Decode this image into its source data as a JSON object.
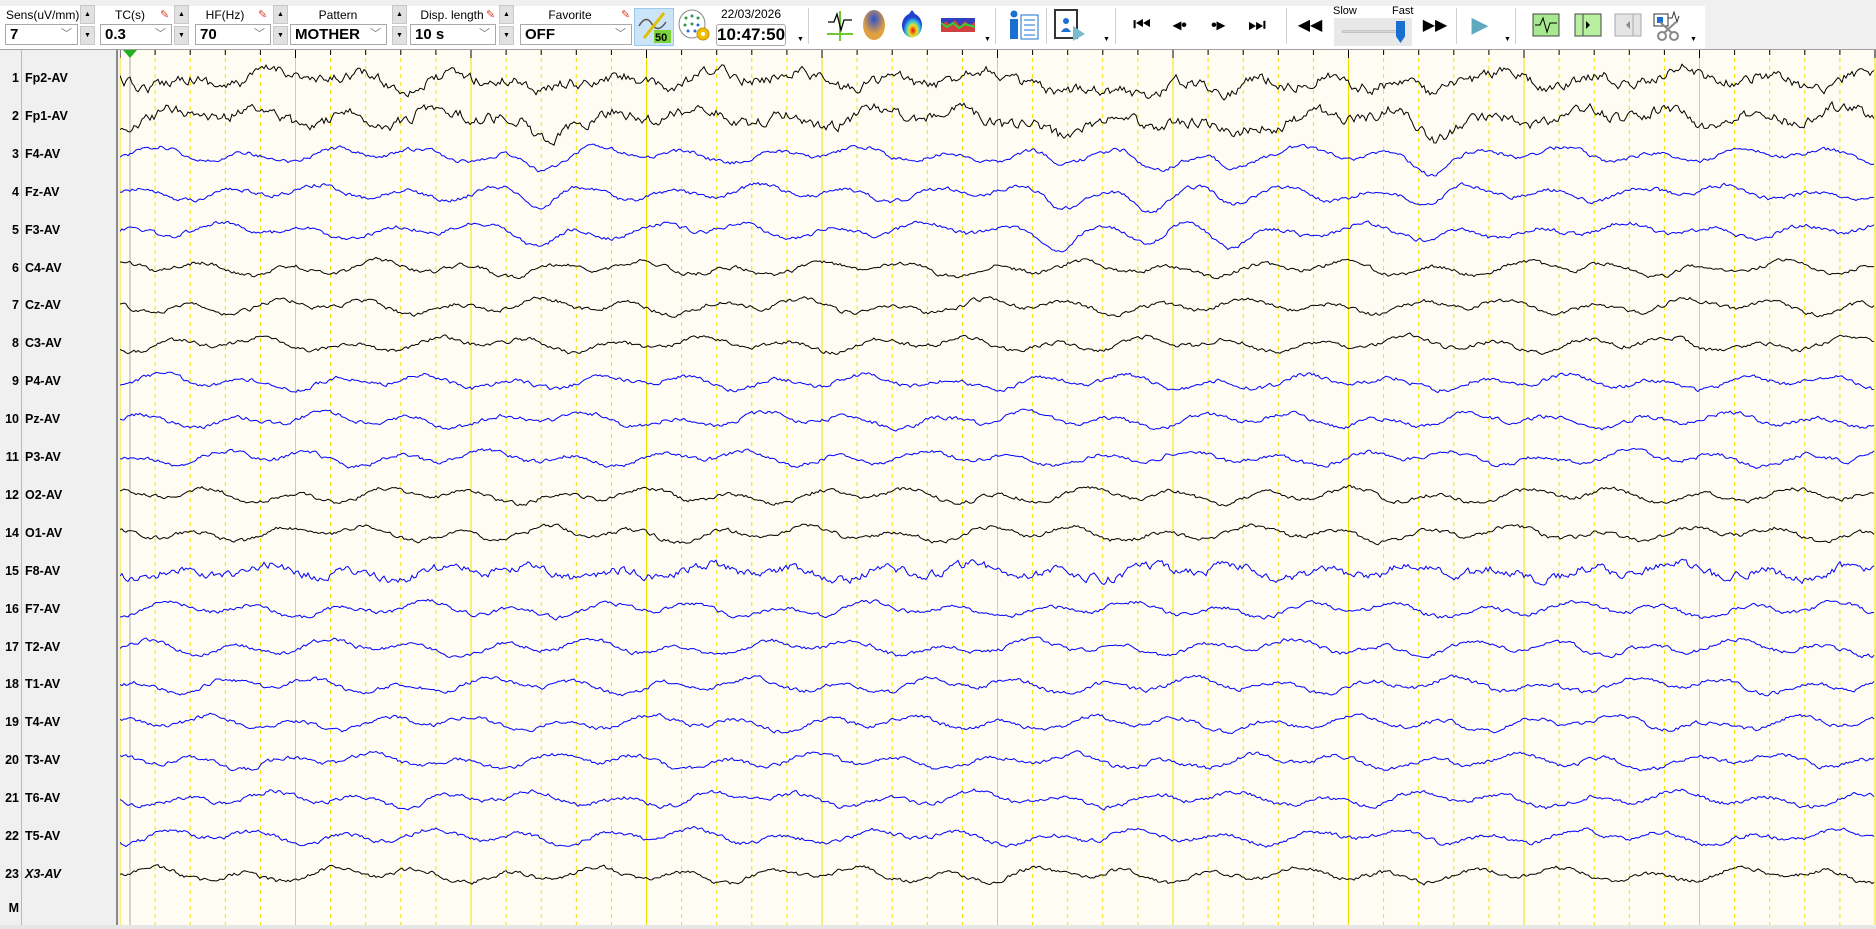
{
  "toolbar": {
    "sens": {
      "label": "Sens(uV/mm)",
      "value": "7"
    },
    "tc": {
      "label": "TC(s)",
      "value": "0.3"
    },
    "hf": {
      "label": "HF(Hz)",
      "value": "70"
    },
    "pattern": {
      "label": "Pattern",
      "value": "MOTHER"
    },
    "disp_length": {
      "label": "Disp. length",
      "value": "10 s"
    },
    "favorite": {
      "label": "Favorite",
      "value": "OFF"
    },
    "notch_badge": "50",
    "date": "22/03/2026",
    "time": "10:47:50",
    "speed": {
      "slow": "Slow",
      "fast": "Fast",
      "value": 1.0
    }
  },
  "channels": [
    {
      "n": "1",
      "label": "Fp2-AV",
      "color": "#000000"
    },
    {
      "n": "2",
      "label": "Fp1-AV",
      "color": "#000000"
    },
    {
      "n": "3",
      "label": "F4-AV",
      "color": "#0000ff"
    },
    {
      "n": "4",
      "label": "Fz-AV",
      "color": "#0000ff"
    },
    {
      "n": "5",
      "label": "F3-AV",
      "color": "#0000ff"
    },
    {
      "n": "6",
      "label": "C4-AV",
      "color": "#000000"
    },
    {
      "n": "7",
      "label": "Cz-AV",
      "color": "#000000"
    },
    {
      "n": "8",
      "label": "C3-AV",
      "color": "#000000"
    },
    {
      "n": "9",
      "label": "P4-AV",
      "color": "#0000ff"
    },
    {
      "n": "10",
      "label": "Pz-AV",
      "color": "#0000ff"
    },
    {
      "n": "11",
      "label": "P3-AV",
      "color": "#0000ff"
    },
    {
      "n": "12",
      "label": "O2-AV",
      "color": "#000000"
    },
    {
      "n": "14",
      "label": "O1-AV",
      "color": "#000000"
    },
    {
      "n": "15",
      "label": "F8-AV",
      "color": "#0000ff"
    },
    {
      "n": "16",
      "label": "F7-AV",
      "color": "#0000ff"
    },
    {
      "n": "17",
      "label": "T2-AV",
      "color": "#0000ff"
    },
    {
      "n": "18",
      "label": "T1-AV",
      "color": "#0000ff"
    },
    {
      "n": "19",
      "label": "T4-AV",
      "color": "#0000ff"
    },
    {
      "n": "20",
      "label": "T3-AV",
      "color": "#0000ff"
    },
    {
      "n": "21",
      "label": "T6-AV",
      "color": "#0000ff"
    },
    {
      "n": "22",
      "label": "T5-AV",
      "color": "#0000ff"
    },
    {
      "n": "23",
      "label": "X3-AV",
      "color": "#000000"
    }
  ],
  "marker_row": {
    "label": "M"
  }
}
